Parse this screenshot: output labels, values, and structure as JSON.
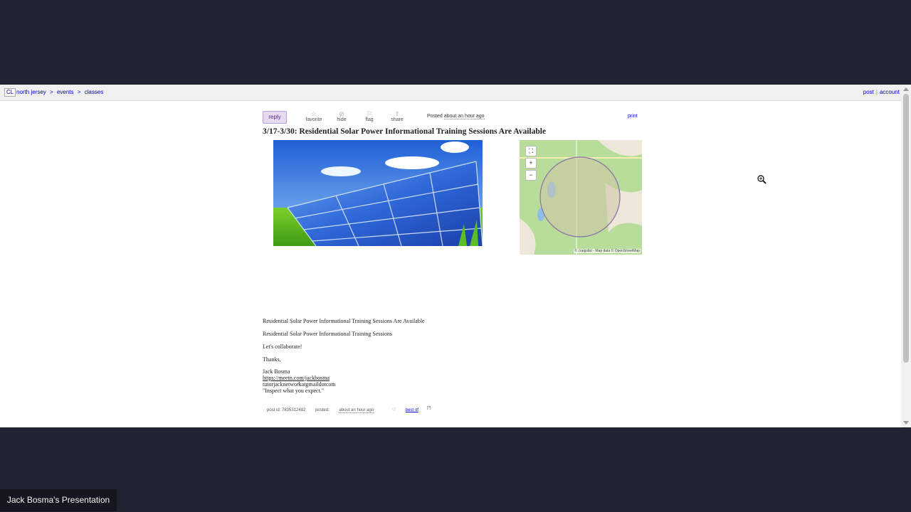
{
  "topbar": {
    "logo": "CL",
    "breadcrumbs": [
      "north jersey",
      ">",
      "events",
      ">",
      "classes"
    ],
    "right_links": [
      "post",
      "account"
    ]
  },
  "actions": {
    "reply": "reply",
    "buttons": [
      {
        "label": "favorite",
        "icon": "star-icon"
      },
      {
        "label": "hide",
        "icon": "hide-icon"
      },
      {
        "label": "flag",
        "icon": "flag-icon"
      },
      {
        "label": "share",
        "icon": "share-icon"
      }
    ],
    "posted_label": "Posted",
    "posted_time": "about an hour ago",
    "print": "print"
  },
  "post": {
    "title": "3/17-3/30: Residential Solar Power Informational Training Sessions Are Available",
    "body": {
      "line1": "Residential Solar Power Informational Training Sessions Are Available",
      "line2": "Residential Solar Power Informational Training Sessions",
      "line3": "Let's collaborate!",
      "line4": "Thanks,",
      "name": "Jack Bosma",
      "link": "https://meetn.com/jackbosma",
      "email": "tutorjacknetworkatgmaildotcom",
      "quote": "\"Inspect what you expect.\""
    }
  },
  "map": {
    "attribution": "© craigslist - Map data © OpenStreetMap",
    "controls": [
      "⛶",
      "+",
      "−"
    ]
  },
  "footer": {
    "post_id": "post id: 7835312482",
    "posted_label": "posted:",
    "posted_time": "about an hour ago",
    "best_of": "best of",
    "best_of_sup": "[?]"
  },
  "presenter": "Jack Bosma's Presentation",
  "colors": {
    "background": "#1f2430",
    "link": "#0000cc",
    "reply_bg": "#e6d9f2"
  }
}
